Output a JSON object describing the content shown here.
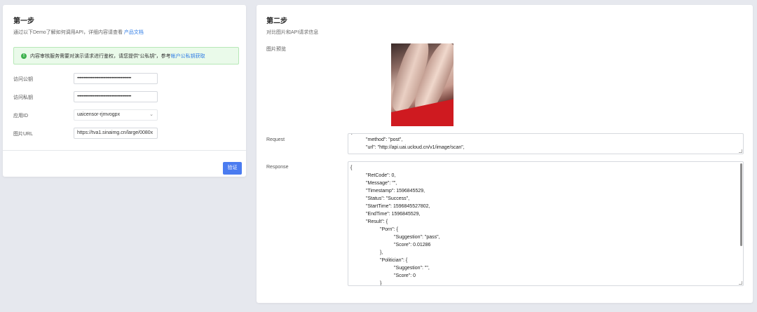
{
  "step1": {
    "title": "第一步",
    "desc_prefix": "通过以下Demo了解如何调用API，详细内容请查看 ",
    "desc_link": "产品文档",
    "notice_text": "内容审核服务需要对演示请求进行鉴权，请您提供“公私钥”，参考 ",
    "notice_link": "帐户公私钥获取",
    "fields": {
      "public_key_label": "访问公钥",
      "public_key_value": "••••••••••••••••••••••••••••••••••••••••••••••••",
      "private_key_label": "访问私钥",
      "private_key_value": "••••••••••••••••••••••••••••••••••••••••••••••••",
      "app_id_label": "应用ID",
      "app_id_value": "uaicensor-rjmvogpx",
      "image_url_label": "图片URL",
      "image_url_value": "https://tva1.sinaimg.cn/large/0080x"
    },
    "verify_button": "验证"
  },
  "step2": {
    "title": "第二步",
    "desc": "对比图片和API请求信息",
    "preview_label": "图片预览",
    "request_label": "Request",
    "request_lines": [
      "\"method\": \"post\",",
      "\"url\": \"http://api.uai.ucloud.cn/v1/image/scan\","
    ],
    "response_label": "Response",
    "response_lines": [
      "{",
      "\"RetCode\": 0,",
      "\"Message\": \"\",",
      "\"Timestamp\": 1596845529,",
      "\"Status\": \"Success\",",
      "\"StartTime\": 1596845527802,",
      "\"EndTime\": 1596845529,",
      "\"Result\": {",
      "\"Porn\": {",
      "\"Suggestion\": \"pass\",",
      "\"Score\": 0.01286",
      "},",
      "\"Politician\": {",
      "\"Suggestion\": \"\",",
      "\"Score\": 0",
      "}"
    ]
  },
  "colors": {
    "accent": "#4a7bf0",
    "link": "#2d7be5",
    "notice_bg": "#eafaea",
    "notice_icon": "#3fb24f",
    "page_bg": "#e6e8ee"
  }
}
